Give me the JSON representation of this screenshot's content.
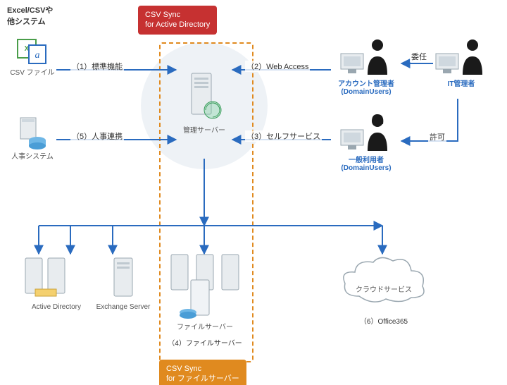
{
  "header": {
    "left_title": "Excel/CSVや\n他システム"
  },
  "badges": {
    "top": {
      "line1": "CSV Sync",
      "line2": "for Active Directory"
    },
    "bottom": {
      "line1": "CSV Sync",
      "line2": "for ファイルサーバー"
    }
  },
  "nodes": {
    "csv_file": "CSV ファイル",
    "hr_system": "人事システム",
    "mgmt_server": "管理サーバー",
    "account_admin1": "アカウント管理者",
    "account_admin2": "(DomainUsers)",
    "it_admin": "IT管理者",
    "general_user1": "一般利用者",
    "general_user2": "(DomainUsers)",
    "ad": "Active Directory",
    "exchange": "Exchange Server",
    "file_server": "ファイルサーバー",
    "cloud": "クラウドサービス"
  },
  "edges": {
    "e1": "（1）標準機能",
    "e2": "（2）Web Access",
    "e3": "（3）セルフサービス",
    "e4": "（4）ファイルサーバー",
    "e5": "（5）人事連携",
    "e6": "（6）Office365",
    "delegate": "委任",
    "permit": "許可"
  },
  "icons": {
    "csv": "csv-file-icon",
    "hr": "database-icon",
    "server": "server-icon",
    "globe": "globe-icon",
    "user_pc": "user-pc-icon",
    "cloud": "cloud-icon"
  }
}
